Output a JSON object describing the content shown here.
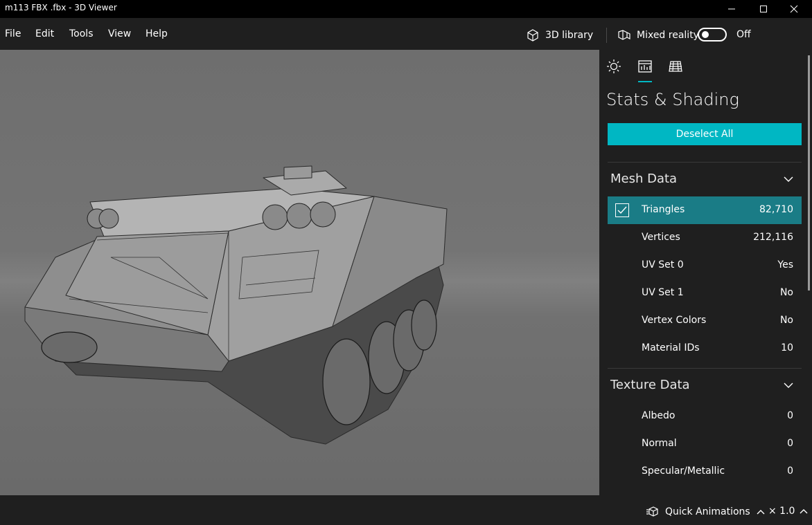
{
  "window": {
    "title": "m113 FBX .fbx - 3D Viewer"
  },
  "menu": {
    "items": [
      "File",
      "Edit",
      "Tools",
      "View",
      "Help"
    ]
  },
  "toolbar": {
    "library_label": "3D library",
    "mixed_reality_label": "Mixed reality",
    "mixed_reality_state": "Off"
  },
  "panel": {
    "active_tab": "stats",
    "title": "Stats & Shading",
    "deselect_label": "Deselect All",
    "mesh": {
      "title": "Mesh Data",
      "rows": [
        {
          "label": "Triangles",
          "value": "82,710",
          "checked": true
        },
        {
          "label": "Vertices",
          "value": "212,116"
        },
        {
          "label": "UV Set 0",
          "value": "Yes"
        },
        {
          "label": "UV Set 1",
          "value": "No"
        },
        {
          "label": "Vertex Colors",
          "value": "No"
        },
        {
          "label": "Material IDs",
          "value": "10"
        }
      ]
    },
    "texture": {
      "title": "Texture Data",
      "rows": [
        {
          "label": "Albedo",
          "value": "0"
        },
        {
          "label": "Normal",
          "value": "0"
        },
        {
          "label": "Specular/Metallic",
          "value": "0"
        }
      ]
    }
  },
  "status": {
    "animations_label": "Quick Animations",
    "speed_label": "× 1.0"
  },
  "colors": {
    "accent": "#00b7c3",
    "selected_row": "#1a7c86",
    "chrome": "#1f1f1f",
    "titlebar": "#000000"
  }
}
